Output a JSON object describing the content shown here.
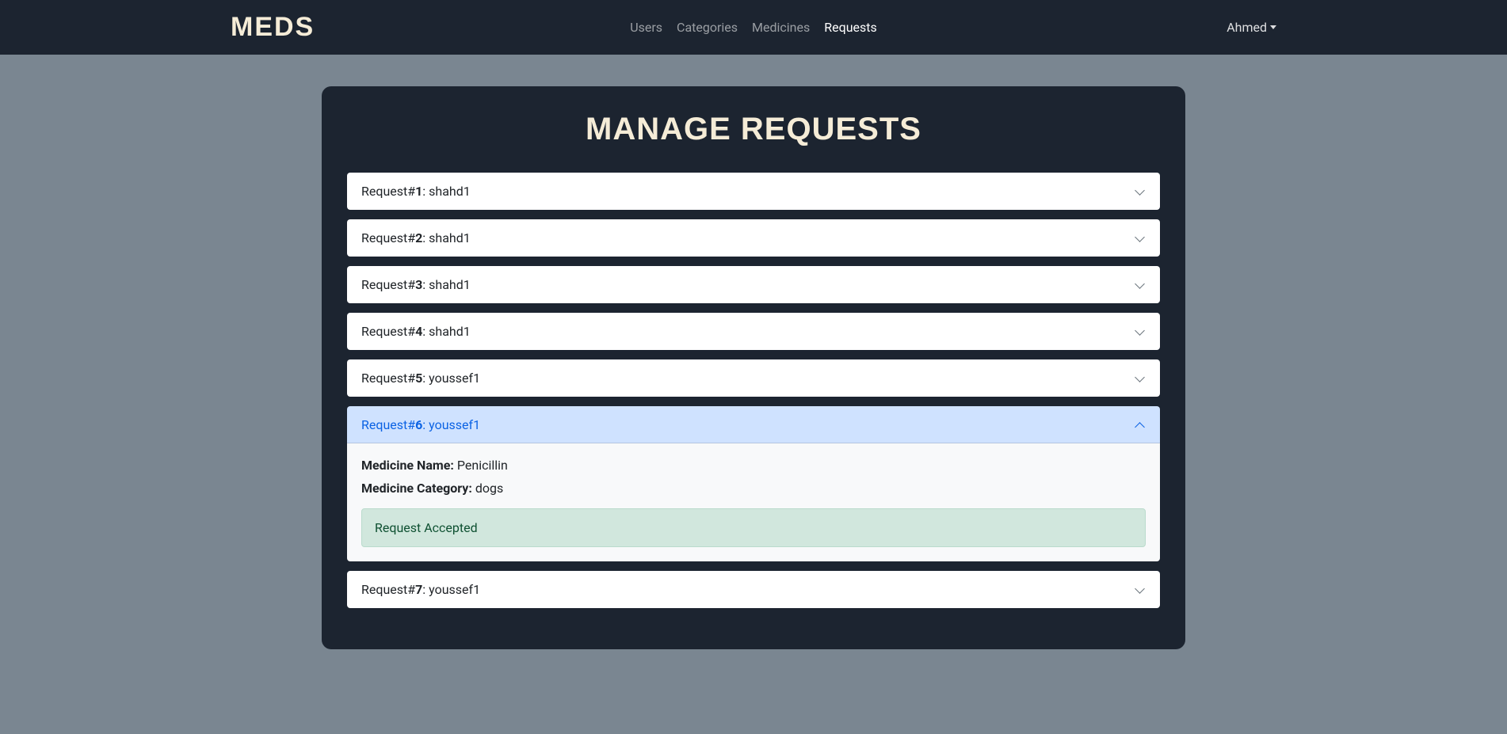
{
  "brand": "MEDS",
  "nav": {
    "users": "Users",
    "categories": "Categories",
    "medicines": "Medicines",
    "requests": "Requests"
  },
  "user_menu": {
    "name": "Ahmed"
  },
  "page_title": "MANAGE REQUESTS",
  "request_prefix": "Request#",
  "separator": ": ",
  "requests": [
    {
      "id": "1",
      "user": "shahd1",
      "expanded": false
    },
    {
      "id": "2",
      "user": "shahd1",
      "expanded": false
    },
    {
      "id": "3",
      "user": "shahd1",
      "expanded": false
    },
    {
      "id": "4",
      "user": "shahd1",
      "expanded": false
    },
    {
      "id": "5",
      "user": "youssef1",
      "expanded": false
    },
    {
      "id": "6",
      "user": "youssef1",
      "expanded": true,
      "medicine_name_label": "Medicine Name:",
      "medicine_name": "Penicillin",
      "medicine_category_label": "Medicine Category:",
      "medicine_category": "dogs",
      "status_message": "Request Accepted"
    },
    {
      "id": "7",
      "user": "youssef1",
      "expanded": false
    }
  ]
}
